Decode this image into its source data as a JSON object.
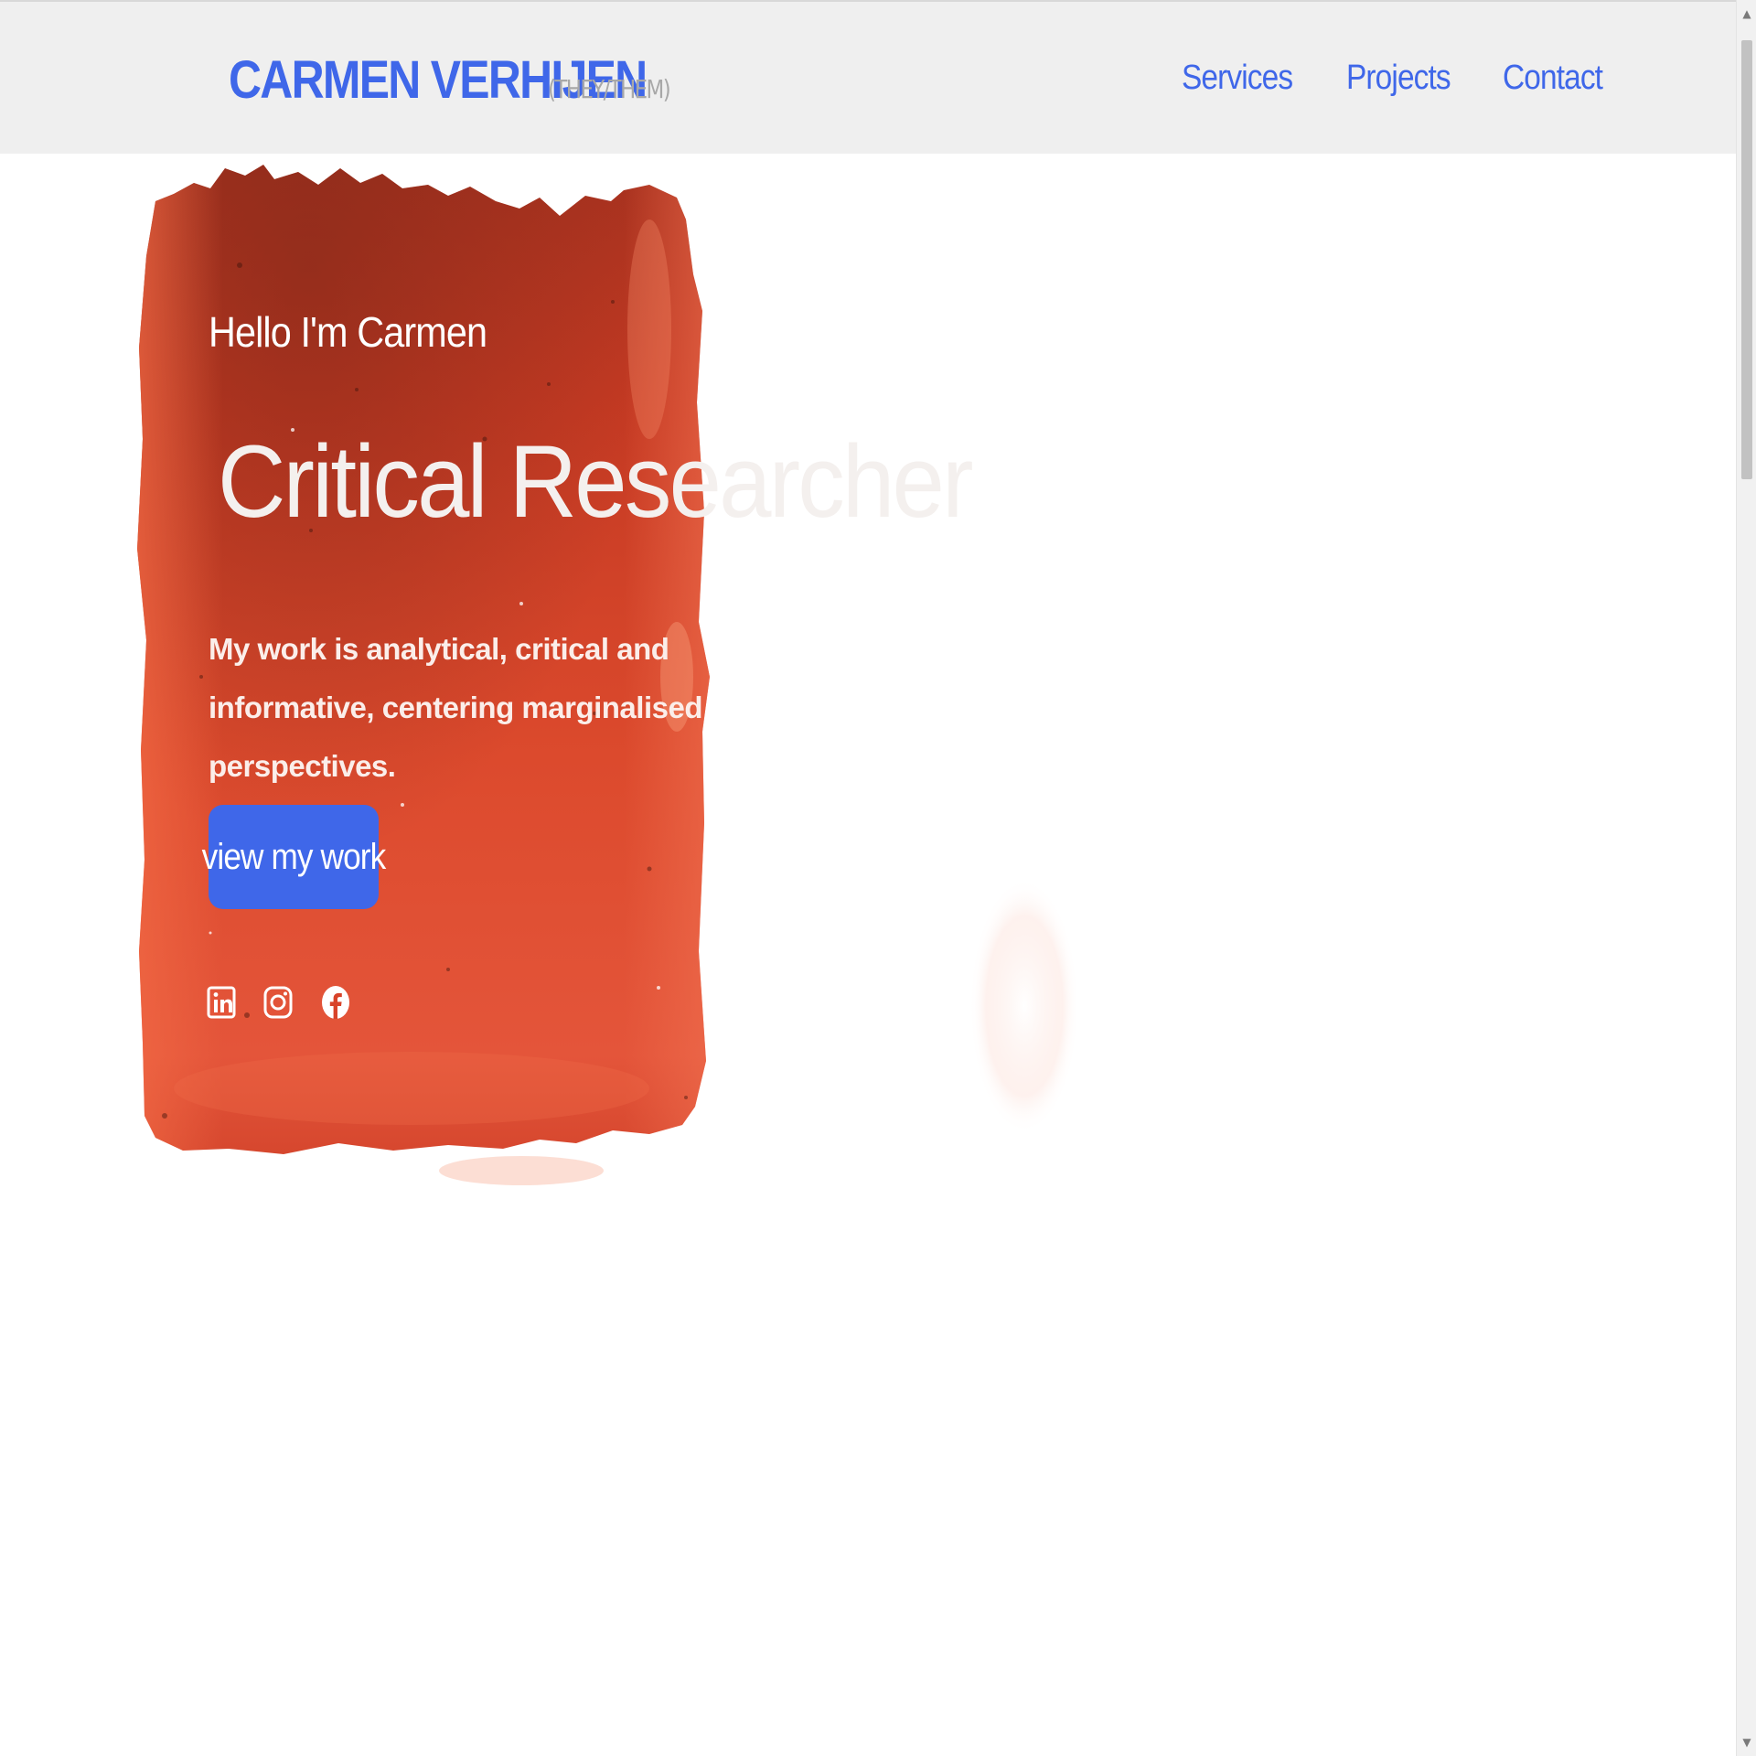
{
  "header": {
    "brand_name": "CARMEN VERHIJEN",
    "brand_pronouns": "(THEY/THEM)",
    "nav": [
      {
        "label": "Services"
      },
      {
        "label": "Projects"
      },
      {
        "label": "Contact"
      }
    ]
  },
  "hero": {
    "greeting": "Hello I'm Carmen",
    "role": "Critical Researcher",
    "tagline": "My work is analytical, critical and informative, centering marginalised perspectives.",
    "cta_label": "view my work",
    "socials": [
      {
        "icon": "linkedin-icon"
      },
      {
        "icon": "instagram-icon"
      },
      {
        "icon": "facebook-icon"
      }
    ]
  },
  "colors": {
    "accent": "#3f67e9",
    "header_bg": "#efefef",
    "paint_red": "#d8432a",
    "pronoun_gray": "#a8a8a8"
  },
  "scrollbar": {
    "up_arrow": "▲",
    "down_arrow": "▼"
  }
}
